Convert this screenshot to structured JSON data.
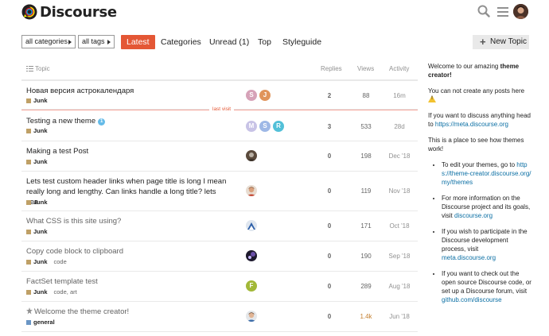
{
  "header": {
    "logo_text": "Discourse",
    "icons": [
      "search-icon",
      "hamburger-menu-icon",
      "user-avatar"
    ]
  },
  "nav": {
    "category_dropdown": "all categories",
    "tags_dropdown": "all tags",
    "items": [
      {
        "label": "Latest",
        "active": true
      },
      {
        "label": "Categories",
        "active": false
      },
      {
        "label": "Unread (1)",
        "active": false
      },
      {
        "label": "Top",
        "active": false
      },
      {
        "label": "Styleguide",
        "active": false
      }
    ],
    "new_topic": "New Topic"
  },
  "table": {
    "columns": {
      "topic": "Topic",
      "replies": "Replies",
      "views": "Views",
      "activity": "Activity"
    },
    "last_visit_label": "last visit",
    "rows": [
      {
        "title": "Новая версия астрокалендаря",
        "category": "Junk",
        "tags": "",
        "badge": "",
        "posters": [
          "S",
          "J"
        ],
        "replies": "2",
        "views": "88",
        "activity": "16m"
      },
      {
        "title": "Testing a new theme",
        "category": "Junk",
        "tags": "",
        "badge": "1",
        "posters": [
          "M",
          "S",
          "R"
        ],
        "replies": "3",
        "views": "533",
        "activity": "28d"
      },
      {
        "title": "Making a test Post",
        "category": "Junk",
        "tags": "",
        "badge": "",
        "posters": [
          ""
        ],
        "replies": "0",
        "views": "198",
        "activity": "Dec '18"
      },
      {
        "title": "Lets test custom header links when page title is long I mean really long and lengthy. Can links handle a long title? lets see",
        "category": "Junk",
        "tags": "",
        "badge": "",
        "posters": [
          ""
        ],
        "replies": "0",
        "views": "119",
        "activity": "Nov '18"
      },
      {
        "title": "What CSS is this site using?",
        "category": "Junk",
        "tags": "",
        "badge": "",
        "posters": [
          ""
        ],
        "replies": "0",
        "views": "171",
        "activity": "Oct '18"
      },
      {
        "title": "Copy code block to clipboard",
        "category": "Junk",
        "tags": "code",
        "badge": "",
        "posters": [
          ""
        ],
        "replies": "0",
        "views": "190",
        "activity": "Sep '18"
      },
      {
        "title": "FactSet template test",
        "category": "Junk",
        "tags": "code, art",
        "badge": "",
        "posters": [
          "F"
        ],
        "replies": "0",
        "views": "289",
        "activity": "Aug '18"
      },
      {
        "title": "Welcome the theme creator!",
        "category": "general",
        "tags": "",
        "badge": "",
        "posters": [
          ""
        ],
        "replies": "0",
        "views": "1.4k",
        "activity": "Jun '18"
      }
    ]
  },
  "sidebar": {
    "welcome_pre": "Welcome to our amazing ",
    "welcome_bold": "theme creator!",
    "no_posts": "You can not create any posts here",
    "discuss_pre": "If you want to discuss anything head to ",
    "discuss_link": "https://meta.discourse.org",
    "place": "This is a place to see how themes work!",
    "bullets": [
      {
        "pre": "To edit your themes, go to ",
        "link": "https://theme-creator.discourse.org/my/themes"
      },
      {
        "pre": "For more information on the Discourse project and its goals, visit ",
        "link": "discourse.org"
      },
      {
        "pre": "If you wish to participate in the Discourse development process, visit ",
        "link": "meta.discourse.org"
      },
      {
        "pre": "If you want to check out the open source Discourse code, or set up a Discourse forum, visit ",
        "link": "github.com/discourse"
      }
    ]
  },
  "colors": {
    "accent": "#e45735",
    "link": "#0b6fa4",
    "category_junk": "#bfa066",
    "category_general": "#6a96c5"
  }
}
